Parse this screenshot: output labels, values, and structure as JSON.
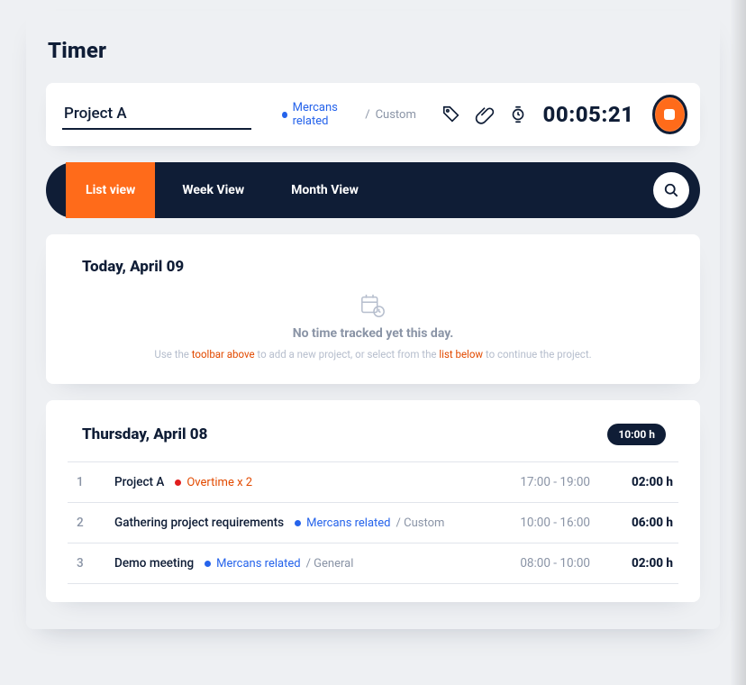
{
  "page": {
    "title": "Timer"
  },
  "timer": {
    "project_name": "Project A",
    "path_label": "Mercans related",
    "path_suffix": "Custom",
    "elapsed": "00:05:21"
  },
  "tabs": {
    "items": [
      {
        "label": "List view",
        "active": true
      },
      {
        "label": "Week View",
        "active": false
      },
      {
        "label": "Month View",
        "active": false
      }
    ]
  },
  "today": {
    "title": "Today, April 09",
    "empty_msg": "No time tracked yet this day.",
    "hint_pre": "Use the ",
    "hint_link1": "toolbar above",
    "hint_mid": " to add a new project, or select from the ",
    "hint_link2": "list below",
    "hint_post": " to continue the project."
  },
  "day": {
    "title": "Thursday, April 08",
    "total": "10:00 h",
    "entries": [
      {
        "idx": "1",
        "name": "Project A",
        "tag": {
          "color": "red",
          "label": "Overtime x 2",
          "suffix": ""
        },
        "range": "17:00 - 19:00",
        "dur": "02:00 h"
      },
      {
        "idx": "2",
        "name": "Gathering project requirements",
        "tag": {
          "color": "blue",
          "label": "Mercans related",
          "suffix": "Custom"
        },
        "range": "10:00 - 16:00",
        "dur": "06:00 h"
      },
      {
        "idx": "3",
        "name": "Demo meeting",
        "tag": {
          "color": "blue",
          "label": "Mercans related",
          "suffix": "General"
        },
        "range": "08:00 - 10:00",
        "dur": "02:00 h"
      }
    ]
  }
}
